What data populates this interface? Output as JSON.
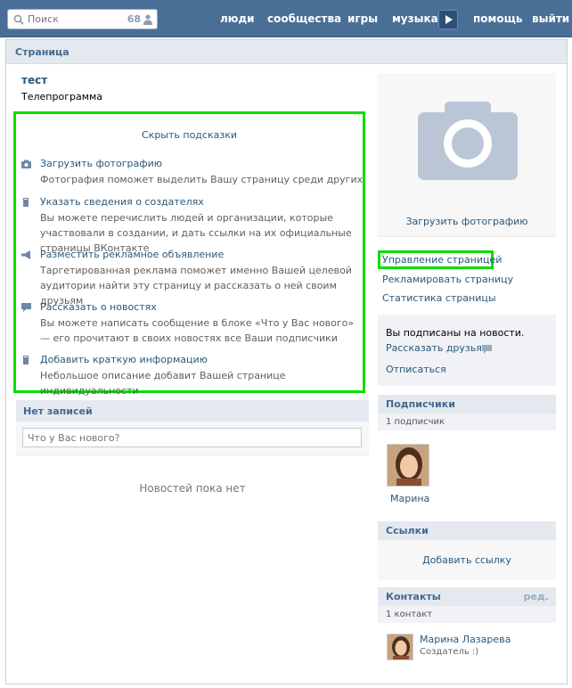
{
  "topbar": {
    "search_placeholder": "Поиск",
    "search_count": "68",
    "nav": [
      "люди",
      "сообщества",
      "игры",
      "музыка",
      "помощь",
      "выйти"
    ]
  },
  "page": {
    "header_title": "Страница",
    "name": "тест",
    "subtitle": "Телепрограмма"
  },
  "hints": {
    "hide_label": "Скрыть подсказки",
    "items": [
      {
        "icon": "camera-icon",
        "title": "Загрузить фотографию",
        "desc": "Фотография поможет выделить Вашу страницу среди других"
      },
      {
        "icon": "document-icon",
        "title": "Указать сведения о создателях",
        "desc": "Вы можете перечислить людей и организации, которые участвовали в создании, и дать ссылки на их официальные страницы ВКонтакте"
      },
      {
        "icon": "megaphone-icon",
        "title": "Разместить рекламное объявление",
        "desc": "Таргетированная реклама поможет именно Вашей целевой аудитории найти эту страницу и рассказать о ней своим друзьям"
      },
      {
        "icon": "speech-bubble-icon",
        "title": "Рассказать о новостях",
        "desc": "Вы можете написать сообщение в блоке «Что у Вас нового» — его прочитают в своих новостях все Ваши подписчики"
      },
      {
        "icon": "document-icon",
        "title": "Добавить краткую информацию",
        "desc": "Небольшое описание добавит Вашей странице индивидуальности"
      }
    ]
  },
  "wall": {
    "header": "Нет записей",
    "input_placeholder": "Что у Вас нового?",
    "empty_text": "Новостей пока нет"
  },
  "side": {
    "upload_photo": "Загрузить фотографию",
    "manage_page": "Управление страницей",
    "advertise_page": "Рекламировать страницу",
    "page_stats": "Статистика страницы",
    "subscribed_text": "Вы подписаны на новости.",
    "tell_friends": "Рассказать друзьям",
    "unsubscribe": "Отписаться",
    "followers_header": "Подписчики",
    "followers_count": "1 подписчик",
    "follower_name": "Марина",
    "links_header": "Ссылки",
    "add_link": "Добавить ссылку",
    "contacts_header": "Контакты",
    "contacts_edit": "ред.",
    "contacts_count": "1 контакт",
    "contact_name": "Марина Лазарева",
    "contact_role": "Создатель :)"
  },
  "colors": {
    "topbar": "#4a6f97",
    "link": "#2b587a",
    "header_bg": "#e3e9ef",
    "highlight": "#00e000"
  }
}
